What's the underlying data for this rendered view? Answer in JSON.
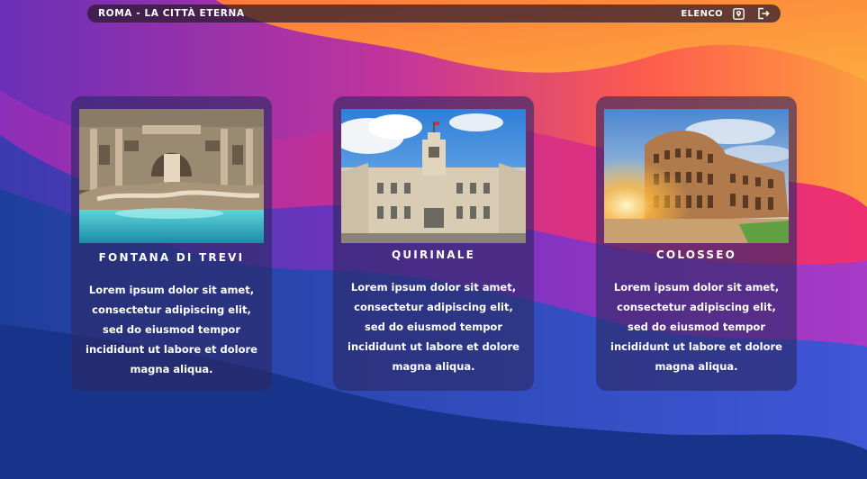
{
  "header": {
    "title": "ROMA - LA CITTÀ ETERNA",
    "list_label": "ELENCO",
    "map_icon": "map-pin-icon",
    "logout_icon": "logout-icon"
  },
  "cards": [
    {
      "name": "FONTANA DI TREVI",
      "description": "Lorem ipsum dolor sit amet, consectetur adipiscing elit, sed do eiusmod tempor incididunt ut labore et dolore magna aliqua.",
      "image_alt": "Trevi Fountain at night"
    },
    {
      "name": "QUIRINALE",
      "description": "Lorem ipsum dolor sit amet, consectetur adipiscing elit, sed do eiusmod tempor incididunt ut labore et dolore magna aliqua.",
      "image_alt": "Quirinal Palace"
    },
    {
      "name": "COLOSSEO",
      "description": "Lorem ipsum dolor sit amet, consectetur adipiscing elit, sed do eiusmod tempor incididunt ut labore et dolore magna aliqua.",
      "image_alt": "Colosseum at sunset"
    }
  ],
  "colors": {
    "wave_orange": "#fd8a3c",
    "wave_pink": "#e8327a",
    "wave_purple": "#7a2fb4",
    "wave_blue": "#2a4db8",
    "background_navy": "#1b3a8c"
  }
}
